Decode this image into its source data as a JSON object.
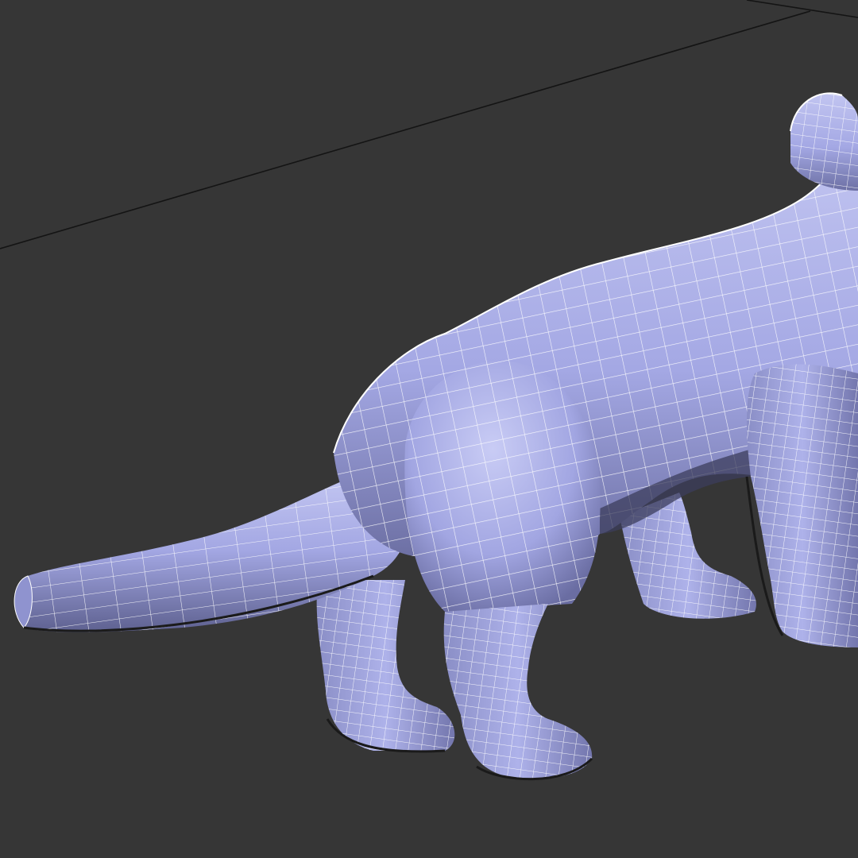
{
  "viewport": {
    "background": "#363636",
    "grid_color": "#141414",
    "shaded": true
  },
  "model": {
    "subject": "quadruped-animal",
    "base_color": "#a4a8e4",
    "highlight_color": "#c4c7f2",
    "shadow_color": "#5f628f",
    "wire_color": "#ffffff",
    "wireframe_overlay": true
  }
}
